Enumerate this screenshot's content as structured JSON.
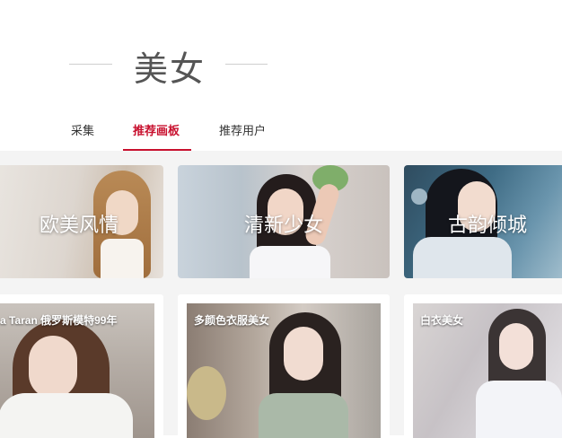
{
  "page": {
    "title": "美女"
  },
  "tabs": [
    {
      "label": "采集",
      "active": false
    },
    {
      "label": "推荐画板",
      "active": true
    },
    {
      "label": "推荐用户",
      "active": false
    }
  ],
  "categories": [
    {
      "label": "欧美风情"
    },
    {
      "label": "清新少女"
    },
    {
      "label": "古韵倾城"
    }
  ],
  "albums": [
    {
      "label": "a  Taran 俄罗斯模特99年"
    },
    {
      "label": "多颜色衣服美女"
    },
    {
      "label": "白衣美女"
    }
  ],
  "colors": {
    "accent": "#c8102e",
    "content_bg": "#f4f4f4"
  }
}
